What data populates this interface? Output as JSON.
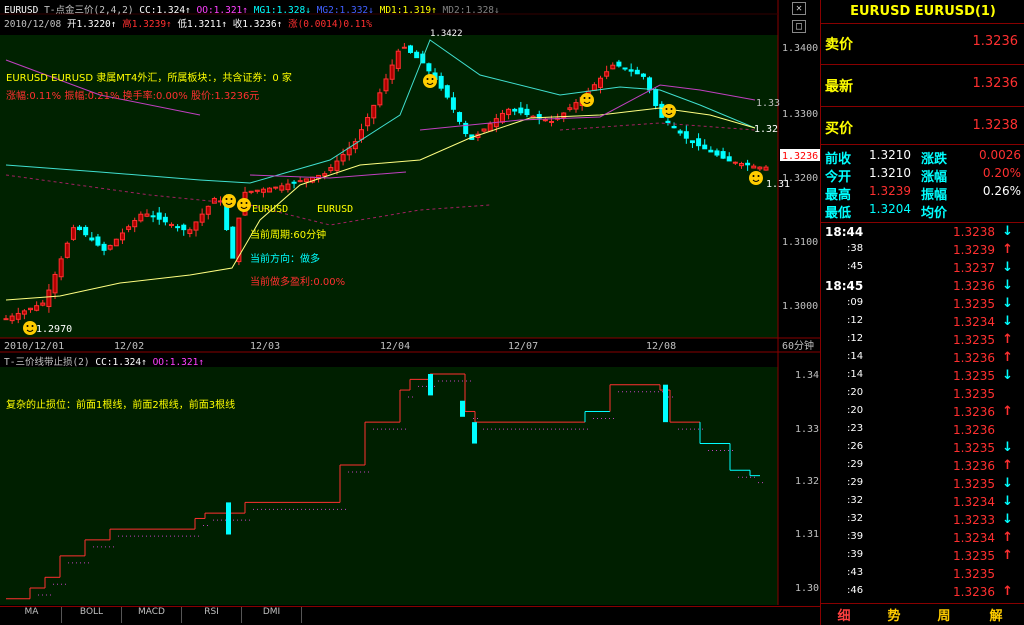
{
  "header": {
    "symbol": "EURUSD",
    "indicator": "T-点金三价(2,4,2)",
    "cc": "CC:1.324↑",
    "oo": "OO:1.321↑",
    "mg1": "MG1:1.328↓",
    "mg2": "MG2:1.332↓",
    "md1": "MD1:1.319↑",
    "md2": "MD2:1.328↓",
    "date": "2010/12/08",
    "open": "开1.3220↑",
    "high": "高1.3239↑",
    "low": "低1.3211↑",
    "close": "收1.3236↑",
    "change": "涨(0.0014)0.11%"
  },
  "info": {
    "line1": "EURUSD EURUSD 隶属MT4外汇，所属板块：，共含证券：0 家",
    "line2": "涨幅:0.11% 振幅:0.21% 换手率:0.00% 股价:1.3236元",
    "label_a": "EURUSD",
    "label_b": "EURUSD",
    "period": "当前周期:60分钟",
    "direction": "当前方向：做多",
    "profit": "当前做多盈利:0.00%",
    "low_mark": "1.2970",
    "high_mark": "1.3422",
    "line_133": "1.33",
    "line_132": "1.32",
    "line_131": "1.31"
  },
  "axis": {
    "price_ticks": [
      "1.3400",
      "1.3300",
      "1.3200",
      "1.3100",
      "1.3000"
    ],
    "current_price": "1.3236",
    "dates": [
      "2010/12/01",
      "12/02",
      "12/03",
      "12/04",
      "12/07",
      "12/08"
    ],
    "period_label": "60分钟",
    "lower_ticks": [
      "1.34",
      "1.33",
      "1.32",
      "1.31",
      "1.30"
    ]
  },
  "lower": {
    "title": "T-三价线带止损(2)",
    "cc": "CC:1.324↑",
    "oo": "OO:1.321↑",
    "note": "复杂的止损位：前面1根线，前面2根线，前面3根线"
  },
  "tabs": [
    "MA",
    "BOLL",
    "MACD",
    "RSI",
    "DMI"
  ],
  "sidebar": {
    "title": "EURUSD EURUSD(1)",
    "sell_label": "卖价",
    "sell_value": "1.3236",
    "last_label": "最新",
    "last_value": "1.3236",
    "buy_label": "买价",
    "buy_value": "1.3238",
    "stats": [
      {
        "l1": "前收",
        "v1": "1.3210",
        "l2": "涨跌",
        "v2": "0.0026"
      },
      {
        "l1": "今开",
        "v1": "1.3210",
        "l2": "涨幅",
        "v2": "0.20%"
      },
      {
        "l1": "最高",
        "v1": "1.3239",
        "l2": "振幅",
        "v2": "0.26%"
      },
      {
        "l1": "最低",
        "v1": "1.3204",
        "l2": "均价",
        "v2": ""
      }
    ],
    "ticks": [
      {
        "t": "18:44",
        "p": "1.3238",
        "d": "down"
      },
      {
        "t": ":38",
        "p": "1.3239",
        "d": "up"
      },
      {
        "t": ":45",
        "p": "1.3237",
        "d": "down"
      },
      {
        "t": "18:45",
        "p": "1.3236",
        "d": "down"
      },
      {
        "t": ":09",
        "p": "1.3235",
        "d": "down"
      },
      {
        "t": ":12",
        "p": "1.3234",
        "d": "down"
      },
      {
        "t": ":12",
        "p": "1.3235",
        "d": "up"
      },
      {
        "t": ":14",
        "p": "1.3236",
        "d": "up"
      },
      {
        "t": ":14",
        "p": "1.3235",
        "d": "down"
      },
      {
        "t": ":20",
        "p": "1.3235",
        "d": ""
      },
      {
        "t": ":20",
        "p": "1.3236",
        "d": "up"
      },
      {
        "t": ":23",
        "p": "1.3236",
        "d": ""
      },
      {
        "t": ":26",
        "p": "1.3235",
        "d": "down"
      },
      {
        "t": ":29",
        "p": "1.3236",
        "d": "up"
      },
      {
        "t": ":29",
        "p": "1.3235",
        "d": "down"
      },
      {
        "t": ":32",
        "p": "1.3234",
        "d": "down"
      },
      {
        "t": ":32",
        "p": "1.3233",
        "d": "down"
      },
      {
        "t": ":39",
        "p": "1.3234",
        "d": "up"
      },
      {
        "t": ":39",
        "p": "1.3235",
        "d": "up"
      },
      {
        "t": ":43",
        "p": "1.3235",
        "d": ""
      },
      {
        "t": ":46",
        "p": "1.3236",
        "d": "up"
      }
    ],
    "tabs": [
      "细",
      "势",
      "周",
      "解"
    ]
  },
  "colors": {
    "up": "#ff3030",
    "down": "#00ffff",
    "bg": "#001a00",
    "label": "#ffff00"
  }
}
